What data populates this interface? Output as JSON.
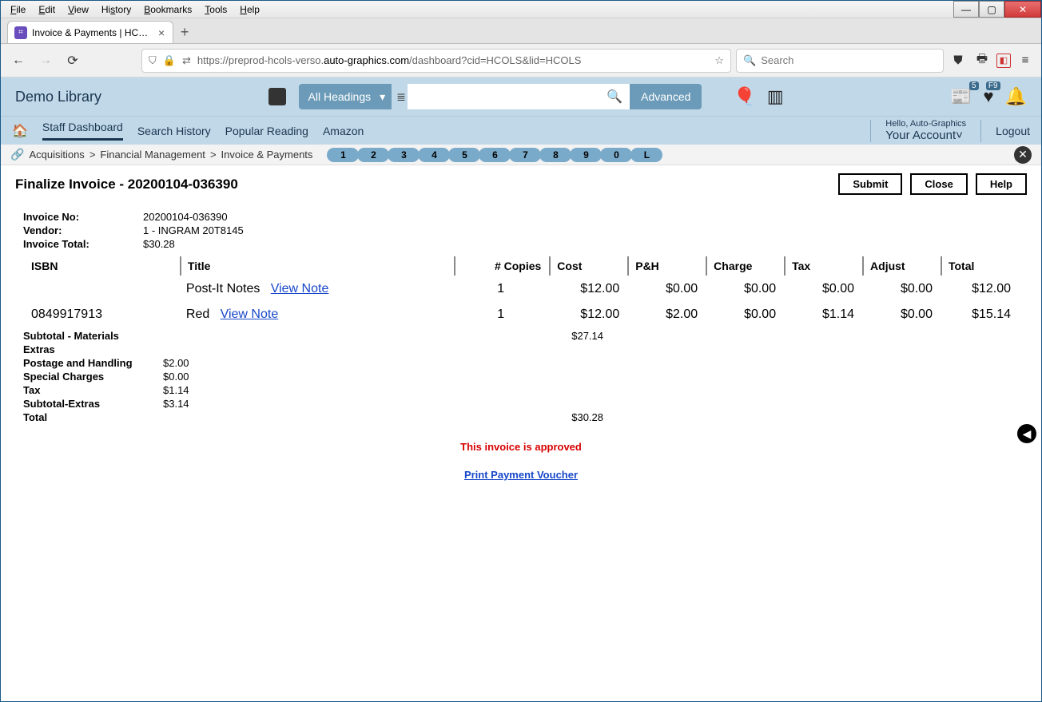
{
  "browser": {
    "menus": [
      "File",
      "Edit",
      "View",
      "History",
      "Bookmarks",
      "Tools",
      "Help"
    ],
    "tab_title": "Invoice & Payments | HCOLS | H",
    "url_prefix": "https://preprod-hcols-verso.",
    "url_domain": "auto-graphics.com",
    "url_path": "/dashboard?cid=HCOLS&lid=HCOLS",
    "search_placeholder": "Search"
  },
  "header": {
    "brand": "Demo Library",
    "dropdown": "All Headings",
    "advanced": "Advanced",
    "badge_news": "5",
    "badge_fav": "F9"
  },
  "nav": {
    "items": [
      "Staff Dashboard",
      "Search History",
      "Popular Reading",
      "Amazon"
    ],
    "hello": "Hello, Auto-Graphics",
    "account": "Your Account",
    "logout": "Logout"
  },
  "breadcrumb": {
    "a": "Acquisitions",
    "b": "Financial Management",
    "c": "Invoice & Payments",
    "chips": [
      "1",
      "2",
      "3",
      "4",
      "5",
      "6",
      "7",
      "8",
      "9",
      "0",
      "L"
    ]
  },
  "page": {
    "title": "Finalize Invoice - 20200104-036390",
    "submit": "Submit",
    "close": "Close",
    "help": "Help"
  },
  "invoice": {
    "labels": {
      "no": "Invoice No:",
      "vendor": "Vendor:",
      "total": "Invoice Total:"
    },
    "no": "20200104-036390",
    "vendor": "1 - INGRAM 20T8145",
    "total": "$30.28"
  },
  "table": {
    "headers": {
      "isbn": "ISBN",
      "title": "Title",
      "copies": "# Copies",
      "cost": "Cost",
      "ph": "P&H",
      "charge": "Charge",
      "tax": "Tax",
      "adjust": "Adjust",
      "total": "Total"
    },
    "viewnote": "View Note",
    "rows": [
      {
        "isbn": "",
        "title": "Post-It Notes",
        "copies": "1",
        "cost": "$12.00",
        "ph": "$0.00",
        "charge": "$0.00",
        "tax": "$0.00",
        "adjust": "$0.00",
        "total": "$12.00"
      },
      {
        "isbn": "0849917913",
        "title": "Red",
        "copies": "1",
        "cost": "$12.00",
        "ph": "$2.00",
        "charge": "$0.00",
        "tax": "$1.14",
        "adjust": "$0.00",
        "total": "$15.14"
      }
    ]
  },
  "subtotals": {
    "materials_lbl": "Subtotal - Materials",
    "materials": "$27.14",
    "extras_lbl": "Extras",
    "ph_lbl": "Postage and Handling",
    "ph": "$2.00",
    "sc_lbl": "Special Charges",
    "sc": "$0.00",
    "tax_lbl": "Tax",
    "tax": "$1.14",
    "subext_lbl": "Subtotal-Extras",
    "subext": "$3.14",
    "total_lbl": "Total",
    "total": "$30.28"
  },
  "messages": {
    "approved": "This invoice is approved",
    "voucher": "Print Payment Voucher"
  }
}
